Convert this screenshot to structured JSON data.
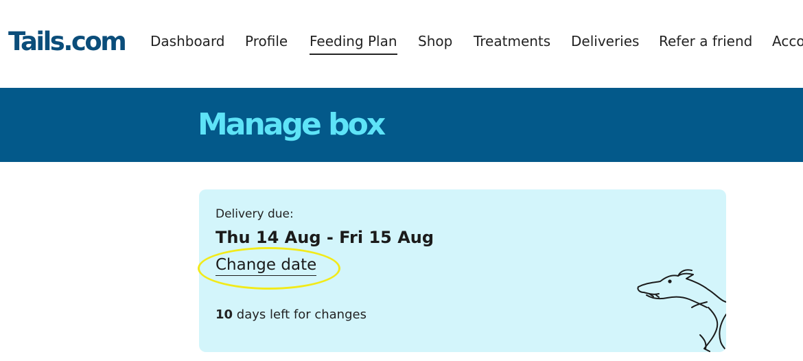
{
  "header": {
    "logo": "Tails.com",
    "nav": [
      {
        "label": "Dashboard"
      },
      {
        "label": "Profile"
      },
      {
        "label": "Feeding Plan",
        "active": true
      },
      {
        "label": "Shop"
      },
      {
        "label": "Treatments"
      },
      {
        "label": "Deliveries"
      },
      {
        "label": "Refer a friend"
      },
      {
        "label": "Acco"
      }
    ]
  },
  "banner": {
    "title": "Manage box"
  },
  "delivery": {
    "label": "Delivery due:",
    "dates": "Thu 14 Aug - Fri 15 Aug",
    "change_link": "Change date",
    "days_left_count": "10",
    "days_left_text": " days left for changes"
  },
  "colors": {
    "brand": "#0b4d7a",
    "banner_bg": "#03598a",
    "banner_title": "#5ee3f7",
    "card_bg": "#d3f5fb",
    "highlight": "#f2ea1a"
  },
  "icons": {
    "illustration": "greyhound-illustration-icon"
  }
}
